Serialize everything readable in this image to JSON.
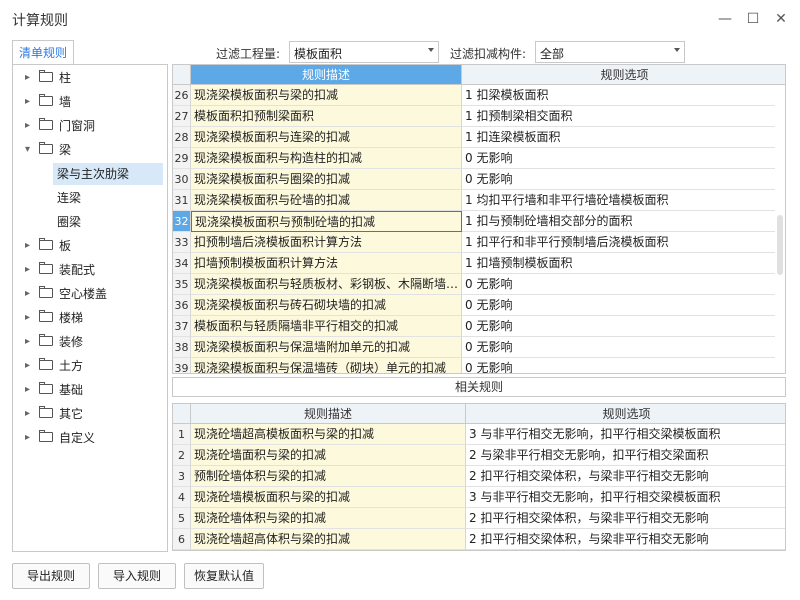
{
  "window": {
    "title": "计算规则",
    "controls": [
      "minimize",
      "maximize",
      "close"
    ]
  },
  "tab": {
    "label": "清单规则"
  },
  "filters": {
    "quantity_label": "过滤工程量:",
    "quantity_value": "模板面积",
    "component_label": "过滤扣减构件:",
    "component_value": "全部"
  },
  "tree": {
    "items": [
      {
        "label": "柱",
        "expanded": false
      },
      {
        "label": "墙",
        "expanded": false
      },
      {
        "label": "门窗洞",
        "expanded": false
      },
      {
        "label": "梁",
        "expanded": true
      },
      {
        "label": "板",
        "expanded": false
      },
      {
        "label": "装配式",
        "expanded": false
      },
      {
        "label": "空心楼盖",
        "expanded": false
      },
      {
        "label": "楼梯",
        "expanded": false
      },
      {
        "label": "装修",
        "expanded": false
      },
      {
        "label": "土方",
        "expanded": false
      },
      {
        "label": "基础",
        "expanded": false
      },
      {
        "label": "其它",
        "expanded": false
      },
      {
        "label": "自定义",
        "expanded": false
      }
    ],
    "children_of_liang": [
      {
        "label": "梁与主次肋梁",
        "selected": true
      },
      {
        "label": "连梁",
        "selected": false
      },
      {
        "label": "圈梁",
        "selected": false
      }
    ]
  },
  "rules_table": {
    "headers": {
      "desc": "规则描述",
      "option": "规则选项"
    },
    "rows": [
      {
        "num": "26",
        "desc": "现浇梁模板面积与梁的扣减",
        "option": "1  扣梁模板面积"
      },
      {
        "num": "27",
        "desc": "模板面积扣预制梁面积",
        "option": "1    扣预制梁相交面积"
      },
      {
        "num": "28",
        "desc": "现浇梁模板面积与连梁的扣减",
        "option": "1  扣连梁模板面积"
      },
      {
        "num": "29",
        "desc": "现浇梁模板面积与构造柱的扣减",
        "option": "0    无影响"
      },
      {
        "num": "30",
        "desc": "现浇梁模板面积与圈梁的扣减",
        "option": "0    无影响"
      },
      {
        "num": "31",
        "desc": "现浇梁模板面积与砼墙的扣减",
        "option": "1  均扣平行墙和非平行墙砼墙模板面积"
      },
      {
        "num": "32",
        "desc": "现浇梁模板面积与预制砼墙的扣减",
        "option": "1  扣与预制砼墙相交部分的面积",
        "selected": true
      },
      {
        "num": "33",
        "desc": "扣预制墙后浇模板面积计算方法",
        "option": "1  扣平行和非平行预制墙后浇模板面积"
      },
      {
        "num": "34",
        "desc": "扣墙预制模板面积计算方法",
        "option": "1    扣墙预制模板面积"
      },
      {
        "num": "35",
        "desc": "现浇梁模板面积与轻质板材、彩钢板、木隔断墙…",
        "option": "0    无影响"
      },
      {
        "num": "36",
        "desc": "现浇梁模板面积与砖石砌块墙的扣减",
        "option": "0    无影响"
      },
      {
        "num": "37",
        "desc": "模板面积与轻质隔墙非平行相交的扣减",
        "option": "0    无影响"
      },
      {
        "num": "38",
        "desc": "现浇梁模板面积与保温墙附加单元的扣减",
        "option": "0    无影响"
      },
      {
        "num": "39",
        "desc": "现浇梁模板面积与保温墙砖（砌块）单元的扣减",
        "option": "0    无影响"
      }
    ]
  },
  "related": {
    "title": "相关规则",
    "headers": {
      "desc": "规则描述",
      "option": "规则选项"
    },
    "rows": [
      {
        "num": "1",
        "desc": "现浇砼墙超高模板面积与梁的扣减",
        "option": "3    与非平行相交无影响，扣平行相交梁模板面积"
      },
      {
        "num": "2",
        "desc": "现浇砼墙面积与梁的扣减",
        "option": "2  与梁非平行相交无影响，扣平行相交梁面积"
      },
      {
        "num": "3",
        "desc": "预制砼墙体积与梁的扣减",
        "option": "2    扣平行相交梁体积，与梁非平行相交无影响"
      },
      {
        "num": "4",
        "desc": "现浇砼墙模板面积与梁的扣减",
        "option": "3    与非平行相交无影响，扣平行相交梁模板面积"
      },
      {
        "num": "5",
        "desc": "现浇砼墙体积与梁的扣减",
        "option": "2    扣平行相交梁体积，与梁非平行相交无影响"
      },
      {
        "num": "6",
        "desc": "现浇砼墙超高体积与梁的扣减",
        "option": "2    扣平行相交梁体积，与梁非平行相交无影响"
      }
    ]
  },
  "buttons": {
    "export": "导出规则",
    "import": "导入规则",
    "restore": "恢复默认值"
  }
}
